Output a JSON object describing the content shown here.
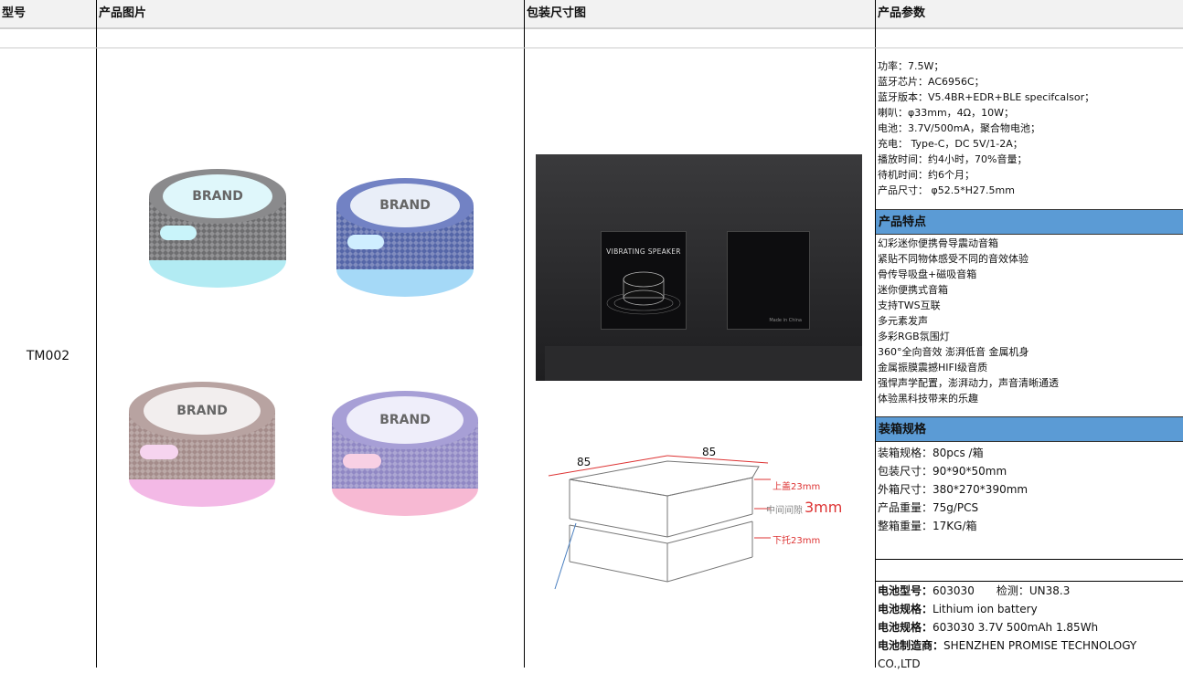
{
  "header": {
    "col1": "型号",
    "col2": "产品图片",
    "col3": "包装尺寸图",
    "col4": "产品参数"
  },
  "model": "TM002",
  "product_images": {
    "brand_text": "BRAND",
    "speakers": [
      {
        "name": "graphite",
        "body": "#7a7a7c",
        "glow": "#9fe6f0"
      },
      {
        "name": "blue",
        "body": "#5a6fb0",
        "glow": "#8fd0f5"
      },
      {
        "name": "rose",
        "body": "#b09896",
        "glow": "#f0a8e0"
      },
      {
        "name": "lavender",
        "body": "#9f96cf",
        "glow": "#f5a8c8"
      }
    ]
  },
  "package_photo": {
    "box_title": "VIBRATING SPEAKER",
    "back_text": "Made in China"
  },
  "dimension_drawing": {
    "width_label": "85",
    "depth_label": "85",
    "top_label": "上盖23mm",
    "gap_label": "中间间隙",
    "gap_value": "3mm",
    "bottom_label": "下托23mm"
  },
  "parameters": [
    "功率：7.5W；",
    "蓝牙芯片：AC6956C；",
    "蓝牙版本：V5.4BR+EDR+BLE specifcalsor；",
    "喇叭：φ33mm，4Ω，10W；",
    "电池：3.7V/500mA，聚合物电池；",
    "充电： Type-C，DC 5V/1-2A；",
    "播放时间：约4小时，70%音量；",
    "待机时间：约6个月；",
    "产品尺寸： φ52.5*H27.5mm"
  ],
  "features_title": "产品特点",
  "features": [
    "幻彩迷你便携骨导震动音箱",
    "紧贴不同物体感受不同的音效体验",
    "骨传导吸盘+磁吸音箱",
    "迷你便携式音箱",
    "支持TWS互联",
    "多元素发声",
    "多彩RGB氛围灯",
    "360°全向音效 澎湃低音 金属机身",
    "金属振膜震撼HIFI级音质",
    "强悍声学配置，澎湃动力，声音清晰通透",
    "体验黑科技带来的乐趣"
  ],
  "packing_title": "装箱规格",
  "packing": [
    "装箱规格：80pcs /箱",
    "包装尺寸：90*90*50mm",
    "外箱尺寸：380*270*390mm",
    "产品重量：75g/PCS",
    "整箱重量：17KG/箱"
  ],
  "battery": {
    "model_label": "电池型号：",
    "model_value": "603030",
    "test_label": "检测：",
    "test_value": "UN38.3",
    "spec1_label": "电池规格：",
    "spec1_value": "Lithium ion battery",
    "spec2_label": "电池规格：",
    "spec2_value": "603030 3.7V 500mAh 1.85Wh",
    "maker_label": "电池制造商：",
    "maker_value": "SHENZHEN PROMISE TECHNOLOGY",
    "maker_value2": "CO.,LTD"
  }
}
